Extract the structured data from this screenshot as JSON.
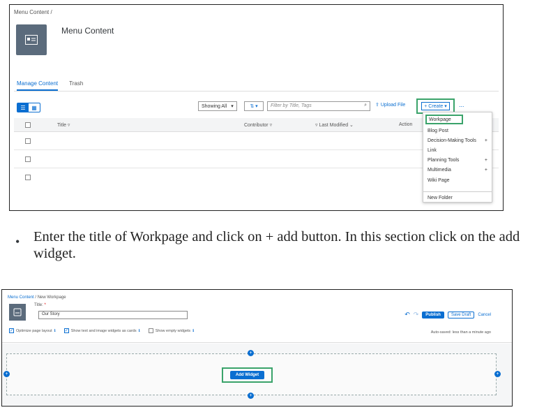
{
  "shot1": {
    "breadcrumb": "Menu Content /",
    "page_title": "Menu Content",
    "tabs": [
      {
        "label": "Manage Content",
        "active": true
      },
      {
        "label": "Trash",
        "active": false
      }
    ],
    "toolbar": {
      "showing": "Showing All",
      "search_placeholder": "Filter by Title, Tags",
      "upload": "Upload File",
      "create": "+ Create",
      "more": "..."
    },
    "table": {
      "headers": {
        "title": "Title",
        "contributor": "Contributor",
        "last_modified": "Last Modified",
        "action": "Action"
      },
      "row_count": 3
    },
    "create_menu": {
      "items": [
        {
          "label": "Workpage",
          "plus": false
        },
        {
          "label": "Blog Post",
          "plus": false
        },
        {
          "label": "Decision-Making Tools",
          "plus": true
        },
        {
          "label": "Link",
          "plus": false
        },
        {
          "label": "Planning Tools",
          "plus": true
        },
        {
          "label": "Multimedia",
          "plus": true
        },
        {
          "label": "Wiki Page",
          "plus": false
        }
      ],
      "footer_item": "New Folder"
    }
  },
  "instruction": {
    "bullet": "•",
    "text": "Enter the title of Workpage and click on + add button. In this section click on the add widget."
  },
  "shot2": {
    "breadcrumb_link": "Menu Content",
    "breadcrumb_rest": " / New Workpage",
    "title_label": "Title:",
    "title_value": "Our Story",
    "publish": "Publish",
    "save_draft": "Save Draft",
    "cancel": "Cancel",
    "options": [
      {
        "label": "Optimize page layout",
        "checked": true
      },
      {
        "label": "Show text and image widgets as cards",
        "checked": true
      },
      {
        "label": "Show empty widgets",
        "checked": false
      }
    ],
    "autosaved": "Auto-saved: less than a minute ago",
    "add_widget": "Add Widget"
  },
  "colors": {
    "accent": "#0a6ed1",
    "highlight": "#3aa36a"
  }
}
